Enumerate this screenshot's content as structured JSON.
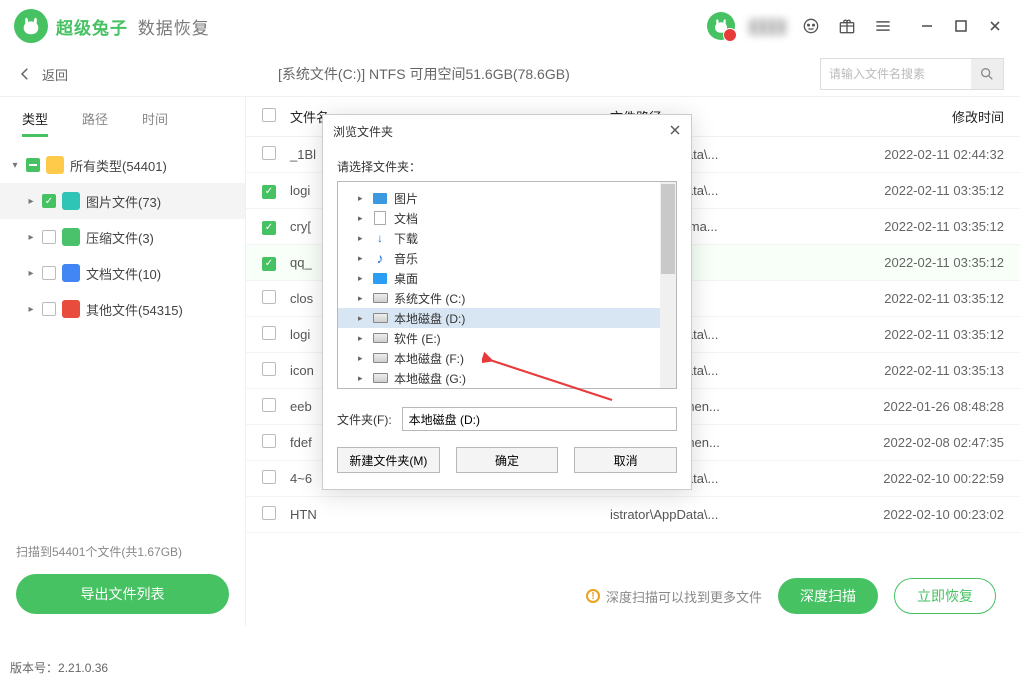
{
  "brand": {
    "name": "超级兔子",
    "sub": "数据恢复"
  },
  "header": {
    "back": "返回",
    "title": "[系统文件(C:)] NTFS 可用空间51.6GB(78.6GB)",
    "search_placeholder": "请输入文件名搜素"
  },
  "tabs": {
    "type": "类型",
    "path": "路径",
    "time": "时间"
  },
  "type_tree": [
    {
      "expand": "down",
      "chk": "half",
      "icon": "c-yellow",
      "label": "所有类型(54401)"
    },
    {
      "expand": "right",
      "chk": "full",
      "icon": "c-teal",
      "label": "图片文件(73)",
      "sel": true
    },
    {
      "expand": "right",
      "chk": "none",
      "icon": "c-green",
      "label": "压缩文件(3)"
    },
    {
      "expand": "right",
      "chk": "none",
      "icon": "c-blue",
      "label": "文档文件(10)"
    },
    {
      "expand": "right",
      "chk": "none",
      "icon": "c-red",
      "label": "其他文件(54315)"
    }
  ],
  "scan_info": "扫描到54401个文件(共1.67GB)",
  "export_btn": "导出文件列表",
  "cols": {
    "name": "文件名",
    "path": "文件路径",
    "date": "修改时间"
  },
  "rows": [
    {
      "chk": false,
      "name": "_1Bl",
      "path": "istrator\\AppData\\...",
      "date": "2022-02-11 02:44:32"
    },
    {
      "chk": true,
      "name": "logi",
      "path": "istrator\\AppData\\...",
      "date": "2022-02-11 03:35:12"
    },
    {
      "chk": true,
      "name": "cry[",
      "path": "embly\\NativeIma...",
      "date": "2022-02-11 03:35:12"
    },
    {
      "chk": true,
      "name": "qq_",
      "path": "",
      "date": "2022-02-11 03:35:12",
      "sel": true
    },
    {
      "chk": false,
      "name": "clos",
      "path": "",
      "date": "2022-02-11 03:35:12"
    },
    {
      "chk": false,
      "name": "logi",
      "path": "istrator\\AppData\\...",
      "date": "2022-02-11 03:35:12"
    },
    {
      "chk": false,
      "name": "icon",
      "path": "istrator\\AppData\\...",
      "date": "2022-02-11 03:35:13"
    },
    {
      "chk": false,
      "name": "eeb",
      "path": "istrator\\Documen...",
      "date": "2022-01-26 08:48:28"
    },
    {
      "chk": false,
      "name": "fdef",
      "path": "istrator\\Documen...",
      "date": "2022-02-08 02:47:35"
    },
    {
      "chk": false,
      "name": "4~6",
      "path": "istrator\\AppData\\...",
      "date": "2022-02-10 00:22:59"
    },
    {
      "chk": false,
      "name": "HTN",
      "path": "istrator\\AppData\\...",
      "date": "2022-02-10 00:23:02"
    }
  ],
  "tip": "深度扫描可以找到更多文件",
  "deep_scan": "深度扫描",
  "recover": "立即恢复",
  "version_label": "版本号：",
  "version": "2.21.0.36",
  "modal": {
    "title": "浏览文件夹",
    "prompt": "请选择文件夹：",
    "tree": [
      {
        "icon": "pictures",
        "label": "图片"
      },
      {
        "icon": "docs",
        "label": "文档"
      },
      {
        "icon": "dl",
        "label": "下载"
      },
      {
        "icon": "music",
        "label": "音乐"
      },
      {
        "icon": "desktop",
        "label": "桌面"
      },
      {
        "icon": "disk",
        "label": "系统文件 (C:)"
      },
      {
        "icon": "disk",
        "label": "本地磁盘 (D:)",
        "sel": true
      },
      {
        "icon": "disk",
        "label": "软件 (E:)"
      },
      {
        "icon": "disk",
        "label": "本地磁盘 (F:)"
      },
      {
        "icon": "disk",
        "label": "本地磁盘 (G:)"
      }
    ],
    "folder_label": "文件夹(F):",
    "folder_value": "本地磁盘 (D:)",
    "new_folder": "新建文件夹(M)",
    "ok": "确定",
    "cancel": "取消"
  }
}
